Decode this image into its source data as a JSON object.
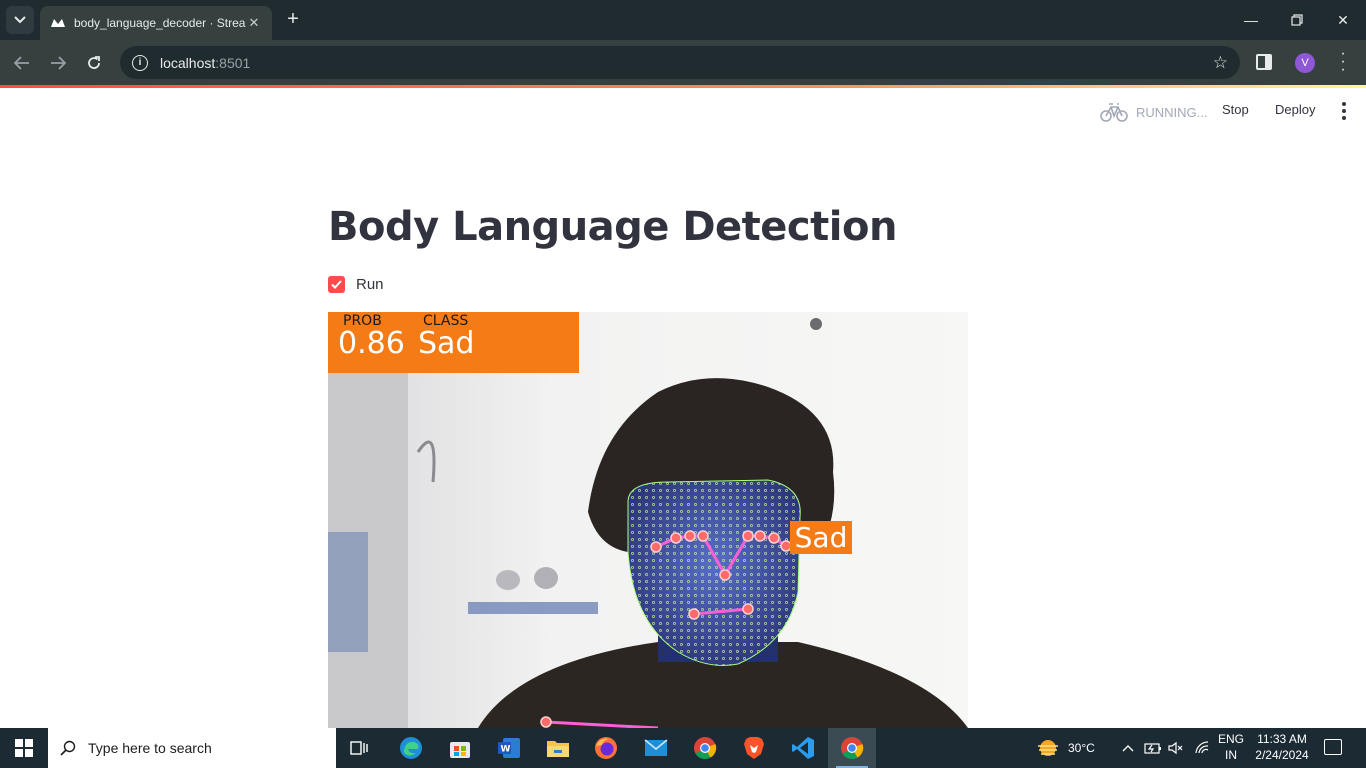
{
  "browser": {
    "tab_title": "body_language_decoder · Strea",
    "url_host": "localhost",
    "url_port": ":8501"
  },
  "streamlit": {
    "status": "RUNNING...",
    "stop_label": "Stop",
    "deploy_label": "Deploy"
  },
  "page": {
    "title": "Body Language Detection",
    "run_checkbox_label": "Run",
    "run_checked": true
  },
  "video_overlay": {
    "prob_label": "PROB",
    "class_label": "CLASS",
    "prob_value": "0.86",
    "class_value": "Sad",
    "face_tag": "Sad"
  },
  "taskbar": {
    "search_placeholder": "Type here to search",
    "weather": "30°C",
    "lang_line1": "ENG",
    "lang_line2": "IN",
    "time": "11:33 AM",
    "date": "2/24/2024",
    "pinned": [
      "task-view",
      "edge",
      "microsoft-store",
      "word",
      "file-explorer",
      "firefox",
      "mail",
      "chrome",
      "brave",
      "vscode",
      "chrome-active"
    ]
  },
  "colors": {
    "accent": "#ff4b4b",
    "overlay_orange": "#f47b16",
    "landmark_green": "#a6ff7a",
    "landmark_pink": "#ff5fd6"
  }
}
